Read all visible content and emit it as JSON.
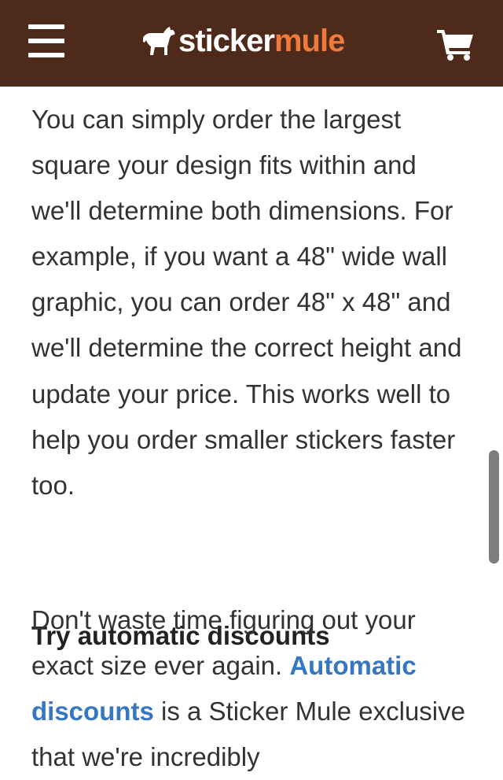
{
  "header": {
    "menu_icon": "hamburger-menu-icon",
    "logo_icon": "mule-icon",
    "logo_word_1": "sticker",
    "logo_word_2": "mule",
    "cart_icon": "shopping-cart-icon",
    "colors": {
      "background": "#4e2a1a",
      "logo_accent": "#ee7a3e",
      "logo_text": "#ffffff"
    }
  },
  "article": {
    "paragraph_1": "You can simply order the largest square your design fits within and we'll determine both dimensions. For example, if you want a 48\" wide wall graphic, you can order 48\" x 48\" and we'll determine the correct height and update your price. This works well to help you order smaller stickers faster too.",
    "heading": "Try automatic discounts",
    "paragraph_2_before_link": "Don't waste time figuring out your exact size ever again. ",
    "paragraph_2_link": "Automatic discounts",
    "paragraph_2_after_link": " is a Sticker Mule exclusive that we're incredibly",
    "colors": {
      "text": "#333333",
      "link": "#3677c0"
    }
  }
}
